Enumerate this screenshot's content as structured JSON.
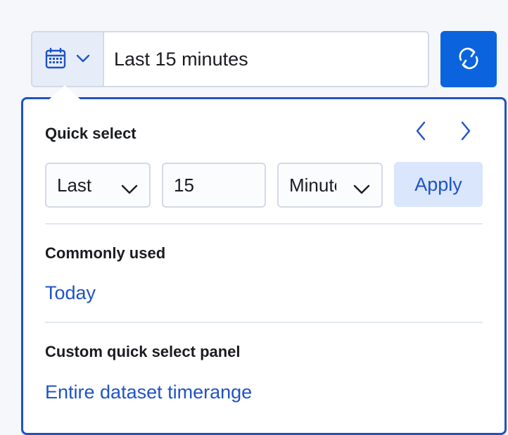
{
  "date_picker": {
    "quick_menu_icon": "calendar-icon",
    "quick_menu_chevron": "chevron-down-icon",
    "range_label": "Last 15 minutes",
    "refresh_icon": "refresh-icon"
  },
  "quick_select": {
    "title": "Quick select",
    "prev_icon": "chevron-left-icon",
    "next_icon": "chevron-right-icon",
    "tense_value": "Last",
    "amount_value": "15",
    "unit_value": "Minutes",
    "apply_label": "Apply"
  },
  "commonly_used": {
    "title": "Commonly used",
    "items": [
      "Today"
    ]
  },
  "custom_panel": {
    "title": "Custom quick select panel",
    "items": [
      "Entire dataset timerange"
    ]
  },
  "colors": {
    "accent": "#0b64dd",
    "link": "#1f53c4",
    "popover_border": "#1f53c4",
    "apply_bg": "#d9e6fb",
    "quick_btn_bg": "#e6edf8"
  }
}
